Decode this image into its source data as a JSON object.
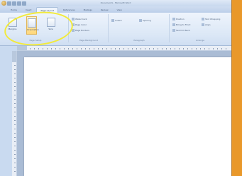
{
  "window": {
    "title": "Document1 - Microsoft Word"
  },
  "tabs": [
    "Home",
    "Insert",
    "Page Layout",
    "References",
    "Mailings",
    "Review",
    "View"
  ],
  "ribbon": {
    "groups": [
      {
        "label": "Page Setup",
        "buttons": [
          "Margins",
          "Orientation",
          "Size"
        ]
      },
      {
        "label": "Page Background",
        "buttons": [
          "Watermark",
          "Page Color",
          "Page Borders"
        ]
      },
      {
        "label": "Paragraph",
        "buttons": [
          "Indent",
          "Spacing"
        ]
      },
      {
        "label": "Arrange",
        "buttons": [
          "Position",
          "Bring to Front",
          "Send to Back",
          "Text Wrapping",
          "Align"
        ]
      }
    ]
  },
  "colors": {
    "background": "#e9982a",
    "highlight": "#f2ea3a"
  }
}
